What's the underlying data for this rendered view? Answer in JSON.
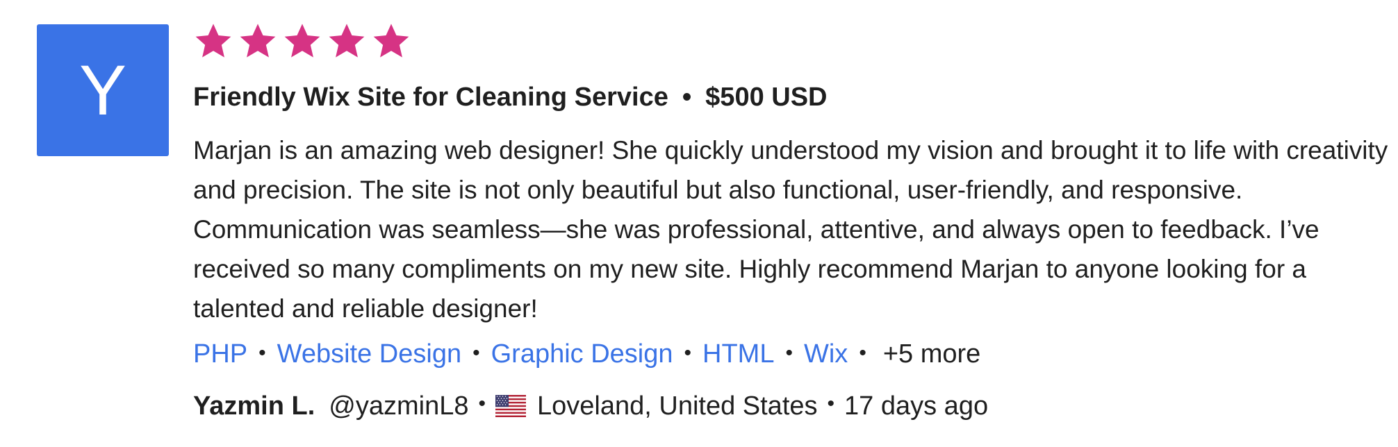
{
  "avatar": {
    "letter": "Y",
    "color": "#3a73e6"
  },
  "rating": {
    "stars": 5,
    "max": 5,
    "star_color": "#d63384"
  },
  "project": {
    "title": "Friendly Wix Site for Cleaning Service",
    "separator": "•",
    "price": "$500 USD"
  },
  "review": {
    "text": "Marjan is an amazing web designer! She quickly understood my vision and brought it to life with creativity and precision. The site is not only beautiful but also functional, user-friendly, and responsive. Communication was seamless—she was professional, attentive, and always open to feedback. I’ve received so many compliments on my new site. Highly recommend Marjan to anyone looking for a talented and reliable designer!"
  },
  "skills": {
    "items": [
      "PHP",
      "Website Design",
      "Graphic Design",
      "HTML",
      "Wix"
    ],
    "more_label": "+5 more",
    "link_color": "#3a73e6"
  },
  "reviewer": {
    "name": "Yazmin L.",
    "handle": "@yazminL8",
    "flag": "us-flag-icon",
    "location": "Loveland, United States",
    "time_ago": "17 days ago"
  }
}
